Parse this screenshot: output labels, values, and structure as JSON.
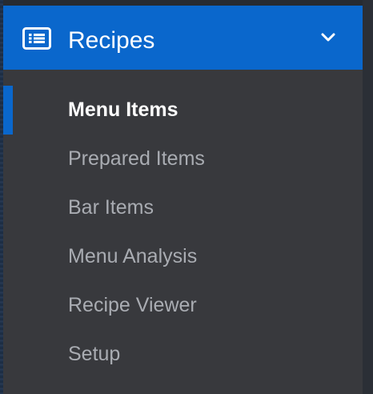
{
  "header": {
    "title": "Recipes",
    "icon": "list-icon",
    "toggle_icon": "chevron-down-icon"
  },
  "menu": {
    "items": [
      {
        "label": "Menu Items",
        "active": true
      },
      {
        "label": "Prepared Items",
        "active": false
      },
      {
        "label": "Bar Items",
        "active": false
      },
      {
        "label": "Menu Analysis",
        "active": false
      },
      {
        "label": "Recipe Viewer",
        "active": false
      },
      {
        "label": "Setup",
        "active": false
      }
    ]
  },
  "colors": {
    "header_bg": "#0a67cc",
    "panel_bg": "#38393d",
    "active_text": "#ffffff",
    "inactive_text": "#a9acb2",
    "active_indicator": "#0a67cc"
  }
}
